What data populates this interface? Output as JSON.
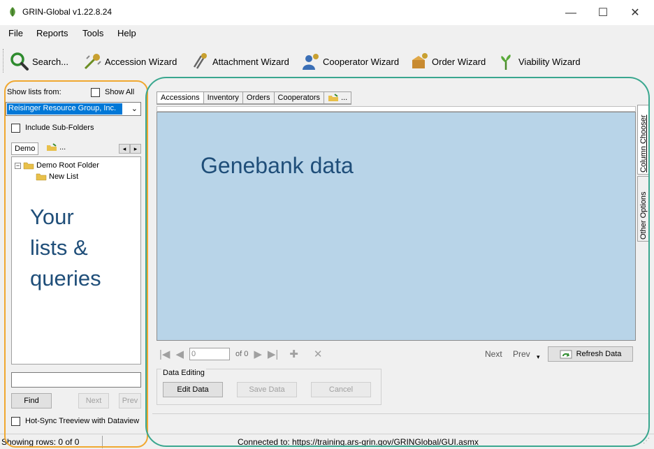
{
  "window": {
    "title": "GRIN-Global v1.22.8.24",
    "minimize_glyph": "—",
    "maximize_glyph": "☐",
    "close_glyph": "✕"
  },
  "menu": [
    "File",
    "Reports",
    "Tools",
    "Help"
  ],
  "toolbar": {
    "buttons": [
      {
        "label": "Search...",
        "icon": "search-icon"
      },
      {
        "label": "Accession Wizard",
        "icon": "accession-wizard-icon"
      },
      {
        "label": "Attachment Wizard",
        "icon": "attachment-wizard-icon"
      },
      {
        "label": "Cooperator Wizard",
        "icon": "cooperator-wizard-icon"
      },
      {
        "label": "Order Wizard",
        "icon": "order-wizard-icon"
      },
      {
        "label": "Viability Wizard",
        "icon": "viability-wizard-icon"
      }
    ]
  },
  "left": {
    "show_lists_from_label": "Show lists from:",
    "show_all_label": "Show All",
    "owner_selected": "Reisinger Resource Group, Inc.",
    "include_subfolders_label": "Include Sub-Folders",
    "tab_active": "Demo",
    "tab_more": "...",
    "tree": {
      "root": "Demo Root Folder",
      "child": "New List"
    },
    "overlay": [
      "Your",
      "lists &",
      "queries"
    ],
    "find_label": "Find",
    "next_label": "Next",
    "prev_label": "Prev",
    "hotsync_label": "Hot-Sync Treeview with Dataview"
  },
  "main": {
    "tabs": [
      "Accessions",
      "Inventory",
      "Orders",
      "Cooperators",
      "..."
    ],
    "grid_overlay": "Genebank data",
    "side_tabs": [
      "Column Chooser",
      "Other Options"
    ],
    "nav": {
      "position": "0",
      "of_text": "of 0",
      "next_text": "Next",
      "prev_text": "Prev",
      "refresh_label": "Refresh Data"
    },
    "data_editing": {
      "group_label": "Data Editing",
      "edit_label": "Edit Data",
      "save_label": "Save Data",
      "cancel_label": "Cancel"
    }
  },
  "status": {
    "rows": "Showing rows: 0 of 0",
    "connection": "Connected to: https://training.ars-grin.gov/GRINGlobal/GUI.asmx"
  },
  "colors": {
    "orange_outline": "#f0a830",
    "teal_outline": "#3aa78f",
    "grid_fill": "#b8d4e8",
    "overlay_text": "#1f4e79"
  }
}
